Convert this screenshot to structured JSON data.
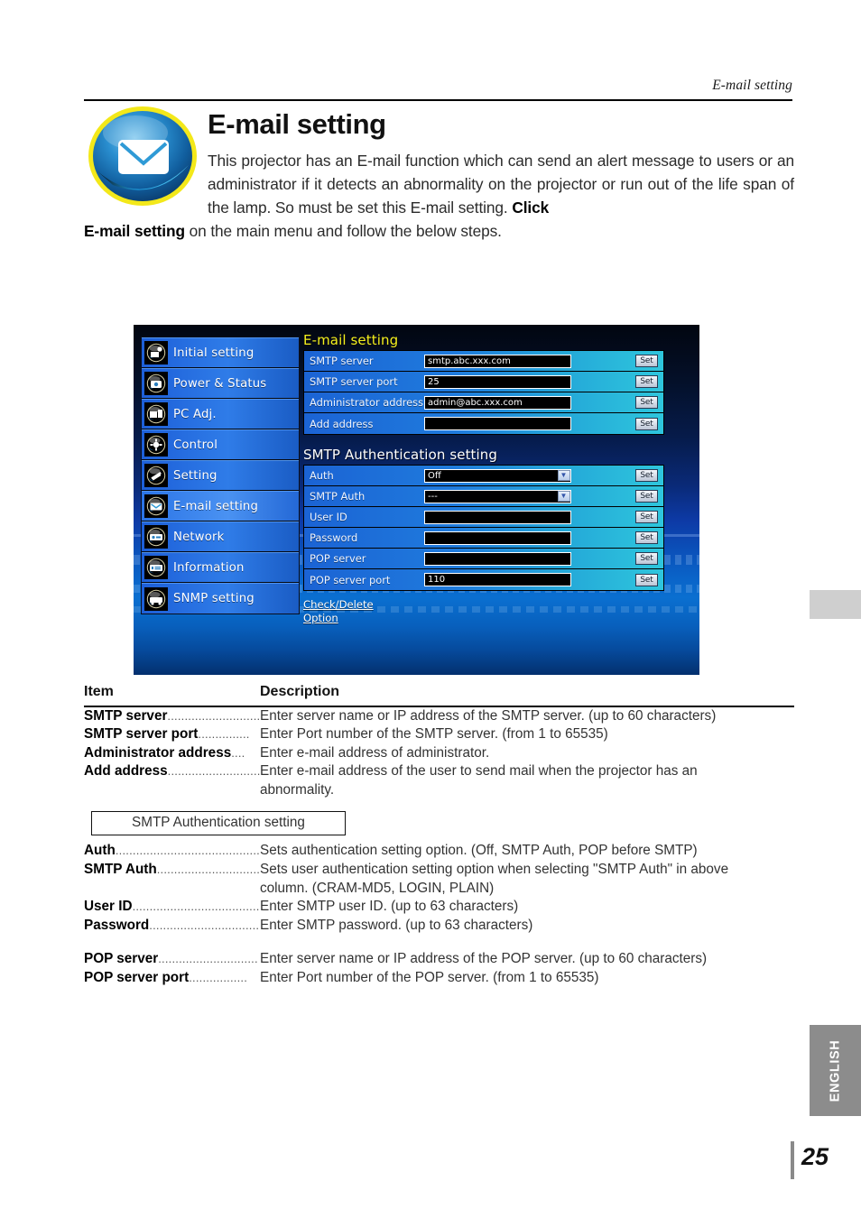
{
  "running_head": "E-mail setting",
  "title": "E-mail setting",
  "intro": {
    "line1": "This projector has an E-mail function which can send an alert message to",
    "line2": "users or an administrator if it detects an abnormality on the projector or",
    "line3_plain": "run out of the life span of the lamp. So must be set this E-mail setting. ",
    "line3_bold": "Click",
    "line4_bold": "E-mail setting",
    "line4_plain": " on the main menu and follow the below steps."
  },
  "screenshot": {
    "sidebar": [
      {
        "label": "Initial setting",
        "icon": "initial-setting-icon"
      },
      {
        "label": "Power & Status",
        "icon": "power-status-icon"
      },
      {
        "label": "PC Adj.",
        "icon": "pc-adj-icon"
      },
      {
        "label": "Control",
        "icon": "control-icon"
      },
      {
        "label": "Setting",
        "icon": "setting-icon"
      },
      {
        "label": "E-mail setting",
        "icon": "email-icon"
      },
      {
        "label": "Network",
        "icon": "network-icon"
      },
      {
        "label": "Information",
        "icon": "information-icon"
      },
      {
        "label": "SNMP setting",
        "icon": "snmp-icon"
      }
    ],
    "selected_sidebar_item": "E-mail setting",
    "section1_title": "E-mail setting",
    "section1_rows": [
      {
        "label": "SMTP server",
        "value": "smtp.abc.xxx.com",
        "type": "text",
        "button": "Set"
      },
      {
        "label": "SMTP server port",
        "value": "25",
        "type": "text",
        "button": "Set"
      },
      {
        "label": "Administrator address",
        "value": "admin@abc.xxx.com",
        "type": "text",
        "button": "Set"
      },
      {
        "label": "Add address",
        "value": "",
        "type": "text",
        "button": "Set"
      }
    ],
    "section2_title": "SMTP Authentication setting",
    "section2_rows": [
      {
        "label": "Auth",
        "value": "Off",
        "type": "select",
        "button": "Set"
      },
      {
        "label": "SMTP Auth",
        "value": "---",
        "type": "select",
        "button": "Set"
      },
      {
        "label": "User ID",
        "value": "",
        "type": "text",
        "button": "Set"
      },
      {
        "label": "Password",
        "value": "",
        "type": "text",
        "button": "Set"
      },
      {
        "label": "POP server",
        "value": "",
        "type": "text",
        "button": "Set"
      },
      {
        "label": "POP server port",
        "value": "110",
        "type": "text",
        "button": "Set"
      }
    ],
    "links": [
      "Check/Delete",
      "Option"
    ],
    "colors": {
      "title_yellow": "#f5f01e",
      "row_left_blue": "#1b63d4",
      "row_right_cyan": "#2ec6dd",
      "nav_blue": "#2f7ce8"
    }
  },
  "desc_table": {
    "head_item": "Item",
    "head_desc": "Description",
    "group1": [
      {
        "item": "SMTP server",
        "dots": "...........................",
        "desc": "Enter server name or IP address of the SMTP server. (up to 60 characters)"
      },
      {
        "item": "SMTP server port",
        "dots": "...............",
        "desc": "Enter Port number of the SMTP server. (from 1 to 65535)"
      },
      {
        "item": "Administrator address",
        "dots": "....",
        "desc": "Enter e-mail address of administrator."
      },
      {
        "item": "Add address",
        "dots": "...........................",
        "desc": "Enter e-mail address of the user to send mail when the projector has an",
        "cont": "abnormality."
      }
    ],
    "box_label": "SMTP Authentication setting",
    "group2": [
      {
        "item": "Auth",
        "dots": "...........................................",
        "desc": "Sets authentication setting option. (Off, SMTP Auth, POP before SMTP)"
      },
      {
        "item": "SMTP Auth",
        "dots": "..............................",
        "desc": "Sets user authentication setting option when selecting \"SMTP Auth\" in above",
        "cont": "column. (CRAM-MD5, LOGIN, PLAIN)"
      },
      {
        "item": "User ID",
        "dots": ".......................................",
        "desc": "Enter SMTP user ID. (up to 63 characters)"
      },
      {
        "item": "Password",
        "dots": "................................",
        "desc": "Enter SMTP password. (up to 63 characters)"
      }
    ],
    "group3": [
      {
        "item": "POP server",
        "dots": ".............................",
        "desc": "Enter server name or IP address of the POP server. (up to 60 characters)"
      },
      {
        "item": "POP server port",
        "dots": ".................",
        "desc": "Enter Port number of the POP server. (from 1 to 65535)"
      }
    ]
  },
  "side_tab": "ENGLISH",
  "page_number": "25"
}
